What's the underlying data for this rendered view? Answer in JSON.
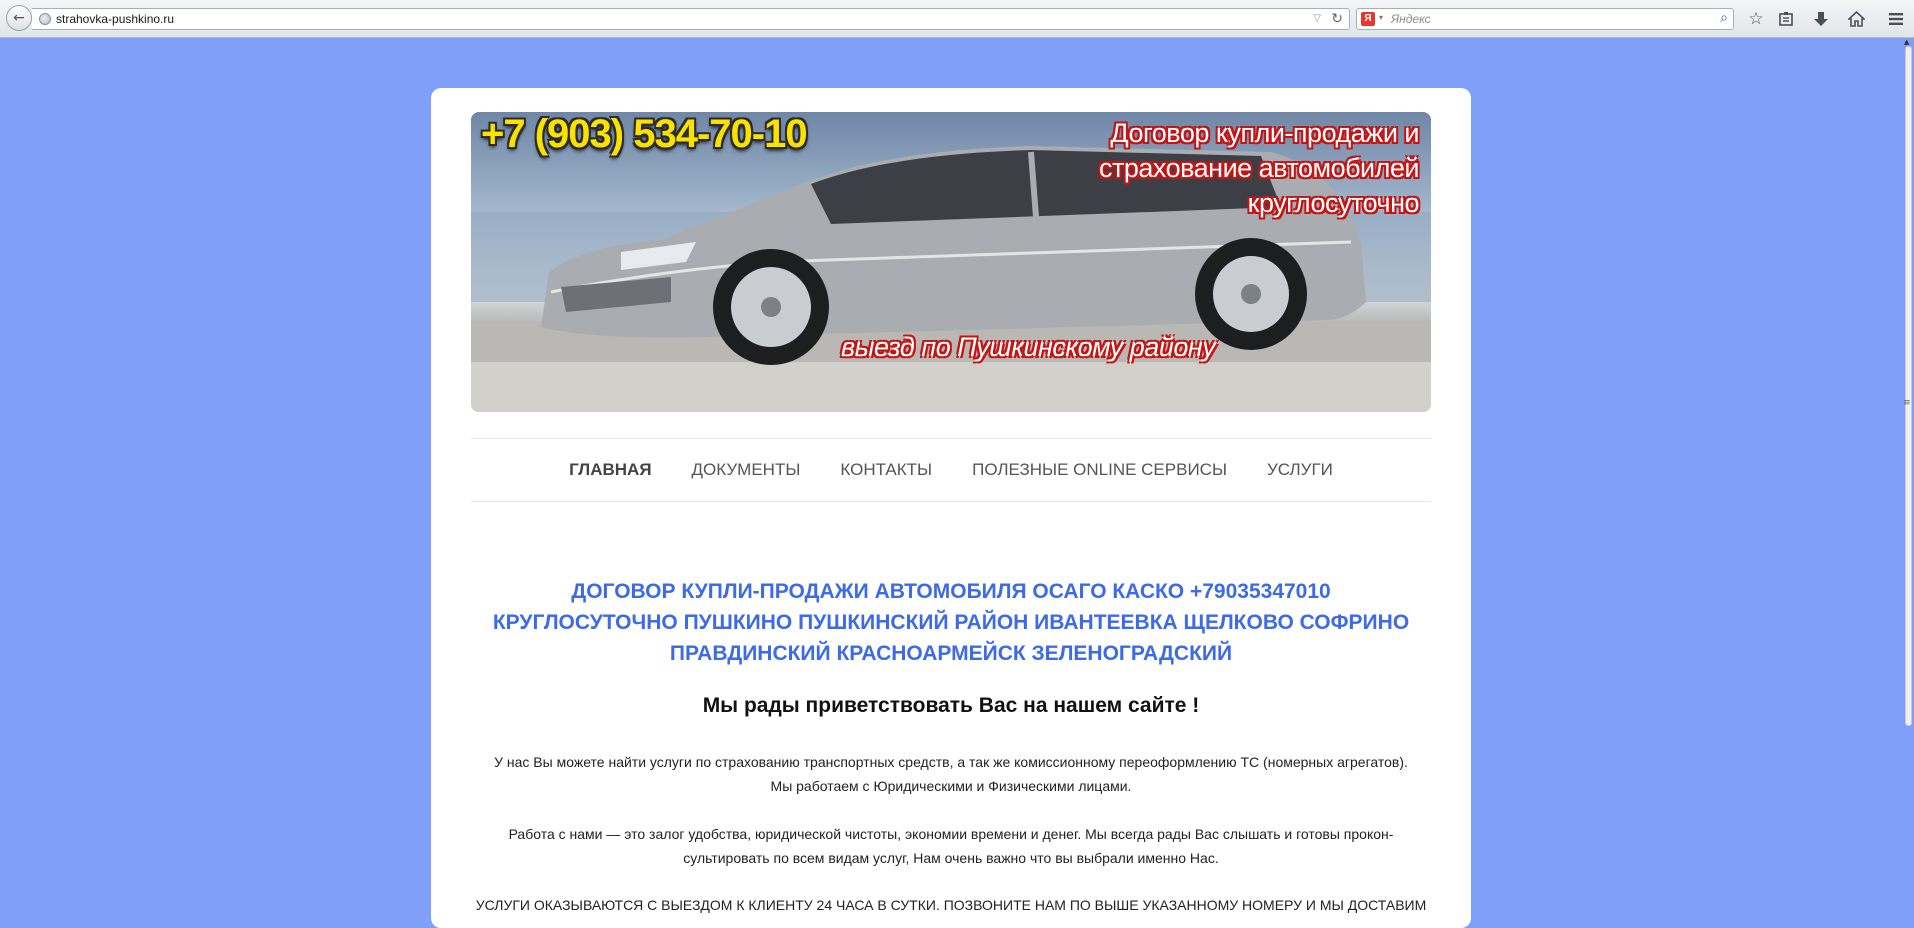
{
  "browser": {
    "url": "strahovka-pushkino.ru",
    "search_placeholder": "Яндекс",
    "search_engine_letter": "Я",
    "icons": [
      "back-icon",
      "globe-icon",
      "dropmarker-icon",
      "reload-icon",
      "yandex-icon",
      "search-icon",
      "bookmark-star-icon",
      "reading-list-icon",
      "download-icon",
      "home-icon",
      "menu-icon"
    ]
  },
  "banner": {
    "phone": "+7 (903) 534-70-10",
    "tagline_lines": [
      "Договор купли-продажи и",
      "страхование автомобилей",
      "круглосуточно"
    ],
    "subline": "выезд по Пушкинскому району"
  },
  "nav": {
    "items": [
      {
        "label": "ГЛАВНАЯ",
        "active": true
      },
      {
        "label": "ДОКУМЕНТЫ",
        "active": false
      },
      {
        "label": "КОНТАКТЫ",
        "active": false
      },
      {
        "label": "ПОЛЕЗНЫЕ ONLINE СЕРВИСЫ",
        "active": false
      },
      {
        "label": "УСЛУГИ",
        "active": false
      }
    ]
  },
  "content": {
    "headline_lines": [
      "ДОГОВОР КУПЛИ-ПРОДАЖИ АВТОМОБИЛЯ ОСАГО КАСКО +79035347010",
      "КРУГЛОСУТОЧНО ПУШКИНО ПУШКИНСКИЙ РАЙОН ИВАНТЕЕВКА ЩЕЛКОВО СОФРИНО",
      "ПРАВДИНСКИЙ КРАСНОАРМЕЙСК ЗЕЛЕНОГРАДСКИЙ"
    ],
    "welcome": "Мы рады приветствовать Вас на нашем сайте !",
    "para1_lines": [
      "У нас Вы можете найти услуги по страхованию транспортных средств, а так же комиссионному переоформлению ТС (номерных агрегатов).",
      "Мы работаем с Юридическими и Физическими лицами."
    ],
    "para2_lines": [
      "Работа с нами — это залог удобства, юридической чистоты, экономии времени и денег. Мы всегда рады Вас слышать и готовы прокон-",
      "сультировать по всем видам услуг, Нам очень важно что вы выбрали именно Нас."
    ],
    "para3_lines": [
      "УСЛУГИ ОКАЗЫВАЮТСЯ С ВЫЕЗДОМ К КЛИЕНТУ 24 ЧАСА В СУТКИ. ПОЗВОНИТЕ НАМ ПО ВЫШЕ УКАЗАННОМУ НОМЕРУ И МЫ ДОСТАВИМ"
    ]
  },
  "colors": {
    "page_background": "#7f9ff8",
    "headline": "#3d6ae6",
    "phone": "#f9e200",
    "banner_text_outline": "#c41414"
  }
}
